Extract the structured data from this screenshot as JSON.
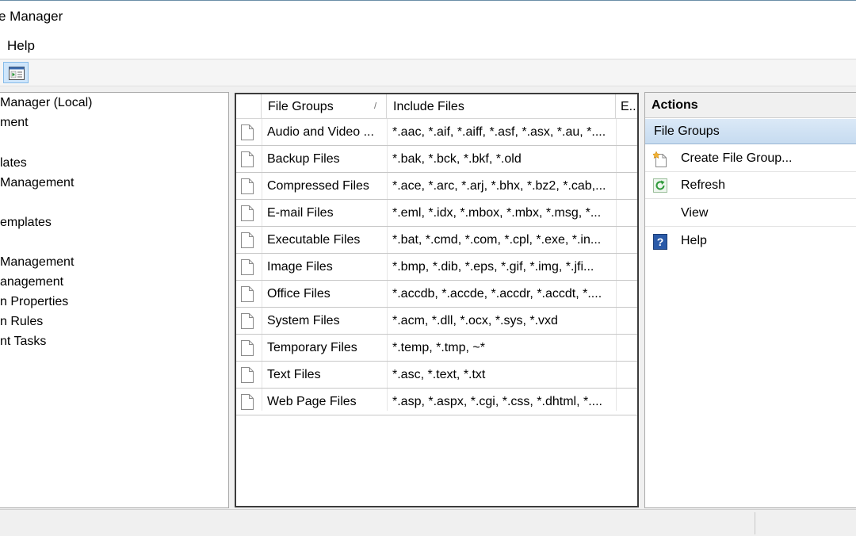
{
  "window": {
    "title": "e Manager"
  },
  "menu": {
    "help": "Help"
  },
  "tree": {
    "items": [
      "Manager (Local)",
      "ment",
      "lates",
      "Management",
      "emplates",
      "Management",
      "anagement",
      "n Properties",
      "n Rules",
      "nt Tasks"
    ]
  },
  "list": {
    "columns": {
      "name": "File Groups",
      "include": "Include Files",
      "exclude": "E.."
    },
    "rows": [
      {
        "name": "Audio and Video ...",
        "include": "*.aac, *.aif, *.aiff, *.asf, *.asx, *.au, *...."
      },
      {
        "name": "Backup Files",
        "include": "*.bak, *.bck, *.bkf, *.old"
      },
      {
        "name": "Compressed Files",
        "include": "*.ace, *.arc, *.arj, *.bhx, *.bz2, *.cab,..."
      },
      {
        "name": "E-mail Files",
        "include": "*.eml, *.idx, *.mbox, *.mbx, *.msg, *..."
      },
      {
        "name": "Executable Files",
        "include": "*.bat, *.cmd, *.com, *.cpl, *.exe, *.in..."
      },
      {
        "name": "Image Files",
        "include": "*.bmp, *.dib, *.eps, *.gif, *.img, *.jfi..."
      },
      {
        "name": "Office Files",
        "include": "*.accdb, *.accde, *.accdr, *.accdt, *...."
      },
      {
        "name": "System Files",
        "include": "*.acm, *.dll, *.ocx, *.sys, *.vxd"
      },
      {
        "name": "Temporary Files",
        "include": "*.temp, *.tmp, ~*"
      },
      {
        "name": "Text Files",
        "include": "*.asc, *.text, *.txt"
      },
      {
        "name": "Web Page Files",
        "include": "*.asp, *.aspx, *.cgi, *.css, *.dhtml, *...."
      }
    ]
  },
  "actions": {
    "header": "Actions",
    "section": "File Groups",
    "items": {
      "create": "Create File Group...",
      "refresh": "Refresh",
      "view": "View",
      "help": "Help"
    }
  },
  "icons": {
    "toolbar": "show-hide-action-pane-icon",
    "file": "document-icon",
    "create": "new-file-group-icon",
    "refresh": "refresh-icon",
    "help": "help-icon"
  },
  "colors": {
    "selection": "#c6dbf0",
    "toolbar_button": "#cfe6fb",
    "help_icon": "#2a5aa8",
    "refresh_icon": "#2e9a3a"
  }
}
